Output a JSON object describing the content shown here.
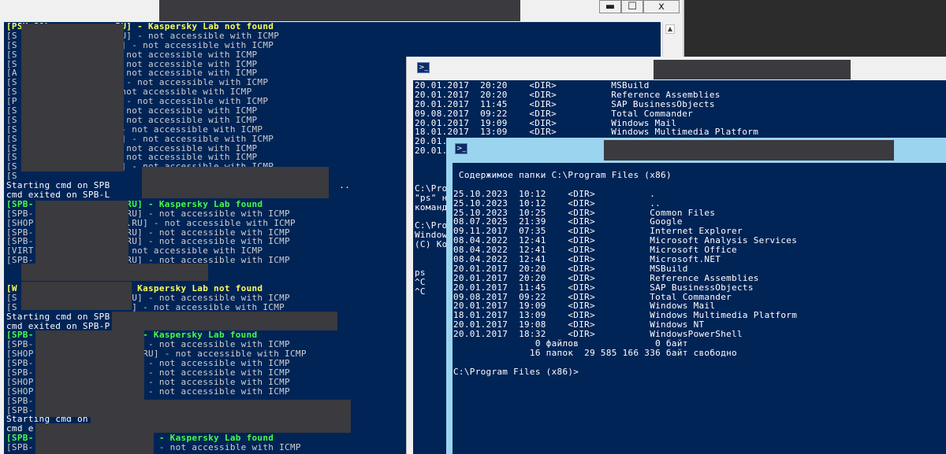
{
  "window_back": {
    "controls": {
      "minimize": "▬",
      "maximize": "☐",
      "close": "x"
    },
    "scroll_up": "▲",
    "lines": [
      [
        {
          "t": "[PSK-SQL            RU] - Kaspersky Lab not found",
          "c": "y"
        }
      ],
      [
        {
          "t": "[S                 .RU] - not accessible with ICMP",
          "c": "g"
        }
      ],
      [
        {
          "t": "[S                 RU] - not accessible with ICMP",
          "c": "g"
        }
      ],
      [
        {
          "t": "[S                ] - not accessible with ICMP",
          "c": "g"
        }
      ],
      [
        {
          "t": "[S                ] - not accessible with ICMP",
          "c": "g"
        }
      ],
      [
        {
          "t": "[A                ] - not accessible with ICMP",
          "c": "g"
        }
      ],
      [
        {
          "t": "[S                 U] - not accessible with ICMP",
          "c": "g"
        }
      ],
      [
        {
          "t": "[S               ] - not accessible with ICMP",
          "c": "g"
        }
      ],
      [
        {
          "t": "[P                 U] - not accessible with ICMP",
          "c": "g"
        }
      ],
      [
        {
          "t": "[S                ] - not accessible with ICMP",
          "c": "g"
        }
      ],
      [
        {
          "t": "[S                ] - not accessible with ICMP",
          "c": "g"
        }
      ],
      [
        {
          "t": "[S                 ] - not accessible with ICMP",
          "c": "g"
        }
      ],
      [
        {
          "t": "[S                 RU] - not accessible with ICMP",
          "c": "g"
        }
      ],
      [
        {
          "t": "[S                ] - not accessible with ICMP",
          "c": "g"
        }
      ],
      [
        {
          "t": "[S                ] - not accessible with ICMP",
          "c": "g"
        }
      ],
      [
        {
          "t": "[S                 RU] - not accessible with ICMP",
          "c": "g"
        }
      ],
      [
        {
          "t": "[S",
          "c": "g"
        }
      ],
      [
        {
          "t": "Starting cmd on SPB                                          ..",
          "c": "w"
        }
      ],
      [
        {
          "t": "cmd exited on SPB-L",
          "c": "w"
        }
      ],
      [
        {
          "t": "[SPB-                .RU] - Kaspersky Lab found",
          "c": "gr"
        }
      ],
      [
        {
          "t": "[SPB-                .RU] - not accessible with ICMP",
          "c": "g"
        }
      ],
      [
        {
          "t": "[SHOP                S.RU] - not accessible with ICMP",
          "c": "g"
        }
      ],
      [
        {
          "t": "[SPB-                .RU] - not accessible with ICMP",
          "c": "g"
        }
      ],
      [
        {
          "t": "[SPB-                .RU] - not accessible with ICMP",
          "c": "g"
        }
      ],
      [
        {
          "t": "[VIRT                - not accessible with ICMP",
          "c": "g"
        }
      ],
      [
        {
          "t": "[SPB-                .RU] - not accessible with ICMP",
          "c": "g"
        }
      ],
      [
        {
          "t": "",
          "c": "g"
        }
      ],
      [
        {
          "t": "",
          "c": "g"
        }
      ],
      [
        {
          "t": "[W                    - Kaspersky Lab not found",
          "c": "y"
        }
      ],
      [
        {
          "t": "[S                   .RU] - not accessible with ICMP",
          "c": "g"
        }
      ],
      [
        {
          "t": "[S                   RU] - not accessible with ICMP",
          "c": "g"
        }
      ],
      [
        {
          "t": "Starting cmd on SPB",
          "c": "w"
        }
      ],
      [
        {
          "t": "cmd exited on SPB-P",
          "c": "w"
        }
      ],
      [
        {
          "t": "[SPB-                    - Kaspersky Lab found",
          "c": "gr"
        }
      ],
      [
        {
          "t": "[SPB-                   ] - not accessible with ICMP",
          "c": "g"
        }
      ],
      [
        {
          "t": "[SHOP                   .RU] - not accessible with ICMP",
          "c": "g"
        }
      ],
      [
        {
          "t": "[SPB-                   ] - not accessible with ICMP",
          "c": "g"
        }
      ],
      [
        {
          "t": "[SPB-                   ] - not accessible with ICMP",
          "c": "g"
        }
      ],
      [
        {
          "t": "[SHOP                   ] - not accessible with ICMP",
          "c": "g"
        }
      ],
      [
        {
          "t": "[SHOP                   ] - not accessible with ICMP",
          "c": "g"
        }
      ],
      [
        {
          "t": "[SPB-",
          "c": "g"
        }
      ],
      [
        {
          "t": "[SPB-",
          "c": "g"
        }
      ],
      [
        {
          "t": "Starting cmd on",
          "c": "w"
        }
      ],
      [
        {
          "t": "cmd e",
          "c": "w"
        }
      ],
      [
        {
          "t": "[SPB-                       - Kaspersky Lab found",
          "c": "gr"
        }
      ],
      [
        {
          "t": "[SPB-                       - not accessible with ICMP",
          "c": "g"
        }
      ]
    ]
  },
  "window_middle": {
    "lines": [
      "20.01.2017  20:20    <DIR>          MSBuild",
      "20.01.2017  20:20    <DIR>          Reference Assemblies",
      "20.01.2017  11:45    <DIR>          SAP BusinessObjects",
      "09.08.2017  09:22    <DIR>          Total Commander",
      "20.01.2017  19:09    <DIR>          Windows Mail",
      "18.01.2017  13:09    <DIR>          Windows Multimedia Platform",
      "20.01.",
      "20.01.",
      "",
      "",
      "",
      "C:\\Pro",
      "\"ps\" н",
      "команд",
      "",
      "C:\\Pro",
      "Window",
      "(C) Ко",
      "",
      "",
      "ps",
      "^C",
      "^C"
    ]
  },
  "window_front": {
    "lines": [
      " Содержимое папки C:\\Program Files (x86)",
      "",
      "25.10.2023  10:12    <DIR>          .",
      "25.10.2023  10:12    <DIR>          ..",
      "25.10.2023  10:25    <DIR>          Common Files",
      "08.07.2025  21:39    <DIR>          Google",
      "09.11.2017  07:35    <DIR>          Internet Explorer",
      "08.04.2022  12:41    <DIR>          Microsoft Analysis Services",
      "08.04.2022  12:41    <DIR>          Microsoft Office",
      "08.04.2022  12:41    <DIR>          Microsoft.NET",
      "20.01.2017  20:20    <DIR>          MSBuild",
      "20.01.2017  20:20    <DIR>          Reference Assemblies",
      "20.01.2017  11:45    <DIR>          SAP BusinessObjects",
      "09.08.2017  09:22    <DIR>          Total Commander",
      "20.01.2017  19:09    <DIR>          Windows Mail",
      "18.01.2017  13:09    <DIR>          Windows Multimedia Platform",
      "20.01.2017  19:08    <DIR>          Windows NT",
      "20.01.2017  18:32    <DIR>          WindowsPowerShell",
      "               0 файлов              0 байт",
      "              16 папок  29 585 166 336 байт свободно",
      "",
      "C:\\Program Files (x86)>"
    ]
  }
}
